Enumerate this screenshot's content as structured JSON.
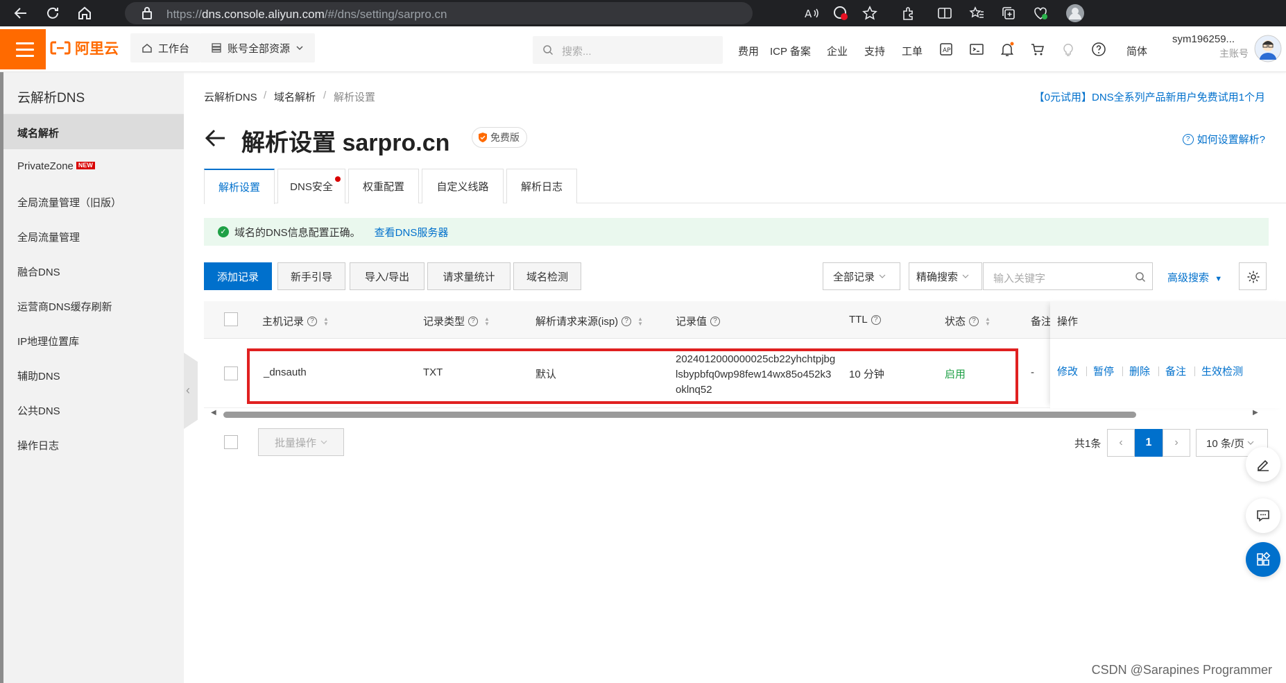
{
  "browser": {
    "url_prefix": "https://",
    "url_host": "dns.console.aliyun.com",
    "url_path": "/#/dns/setting/sarpro.cn"
  },
  "topnav": {
    "logo_text": "阿里云",
    "workbench": "工作台",
    "resources": "账号全部资源",
    "search_placeholder": "搜索...",
    "links": [
      "费用",
      "ICP 备案",
      "企业",
      "支持",
      "工单"
    ],
    "lang": "简体",
    "user_name": "sym196259...",
    "user_role": "主账号"
  },
  "sidebar": {
    "title": "云解析DNS",
    "items": [
      {
        "label": "域名解析"
      },
      {
        "label": "PrivateZone",
        "badge": "NEW"
      },
      {
        "label": "全局流量管理（旧版）"
      },
      {
        "label": "全局流量管理"
      },
      {
        "label": "融合DNS"
      },
      {
        "label": "运营商DNS缓存刷新"
      },
      {
        "label": "IP地理位置库"
      },
      {
        "label": "辅助DNS"
      },
      {
        "label": "公共DNS"
      },
      {
        "label": "操作日志"
      }
    ]
  },
  "breadcrumb": [
    "云解析DNS",
    "域名解析",
    "解析设置"
  ],
  "promo": "【0元试用】DNS全系列产品新用户免费试用1个月",
  "page": {
    "title": "解析设置 sarpro.cn",
    "badge": "免费版",
    "help": "如何设置解析?"
  },
  "tabs": [
    "解析设置",
    "DNS安全",
    "权重配置",
    "自定义线路",
    "解析日志"
  ],
  "notice": {
    "text": "域名的DNS信息配置正确。",
    "link": "查看DNS服务器"
  },
  "toolbar": {
    "add": "添加记录",
    "guide": "新手引导",
    "import_export": "导入/导出",
    "stats": "请求量统计",
    "check": "域名检测",
    "filter": "全部记录",
    "search_mode": "精确搜索",
    "keyword_placeholder": "输入关键字",
    "advanced": "高级搜索"
  },
  "table": {
    "headers": {
      "host": "主机记录",
      "type": "记录类型",
      "line": "解析请求来源(isp)",
      "value": "记录值",
      "ttl": "TTL",
      "status": "状态",
      "remark": "备注",
      "ops": "操作"
    },
    "rows": [
      {
        "host": "_dnsauth",
        "type": "TXT",
        "line": "默认",
        "value_lines": [
          "2024012000000025cb22yhchtpjbg",
          "lsbypbfq0wp98few14wx85o452k3",
          "oklnq52"
        ],
        "ttl": "10 分钟",
        "status": "启用",
        "remark": "-",
        "ops": [
          "修改",
          "暂停",
          "删除",
          "备注",
          "生效检测"
        ]
      }
    ]
  },
  "footer": {
    "bulk": "批量操作",
    "total": "共1条",
    "current_page": "1",
    "page_size": "10 条/页"
  },
  "watermark": "CSDN @Sarapines Programmer",
  "colors": {
    "brand": "#ff6a00",
    "primary": "#0070cc",
    "success": "#1fa046",
    "highlight": "#e02020"
  }
}
